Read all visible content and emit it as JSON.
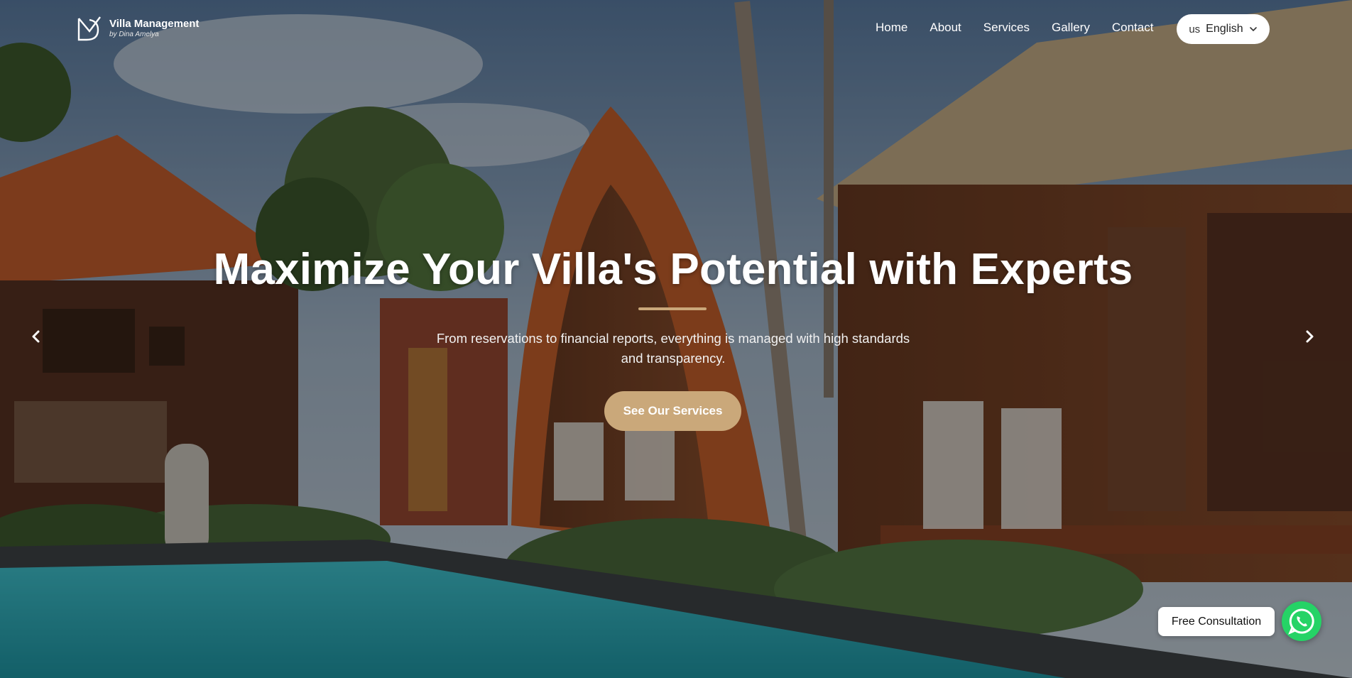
{
  "brand": {
    "name": "Villa Management",
    "tagline": "by Dina Amelya",
    "accent_color": "#caa87a"
  },
  "nav": {
    "items": [
      {
        "label": "Home"
      },
      {
        "label": "About"
      },
      {
        "label": "Services"
      },
      {
        "label": "Gallery"
      },
      {
        "label": "Contact"
      }
    ]
  },
  "language": {
    "flag_code": "us",
    "label": "English",
    "icon": "chevron-down-icon"
  },
  "hero": {
    "title": "Maximize Your Villa's Potential with Experts",
    "subtitle": "From reservations to financial reports, everything is managed with high standards and transparency.",
    "cta_label": "See Our Services",
    "prev_icon": "chevron-left-icon",
    "next_icon": "chevron-right-icon"
  },
  "floating": {
    "consult_label": "Free Consultation",
    "whatsapp_icon": "whatsapp-icon",
    "whatsapp_color": "#25d366"
  }
}
